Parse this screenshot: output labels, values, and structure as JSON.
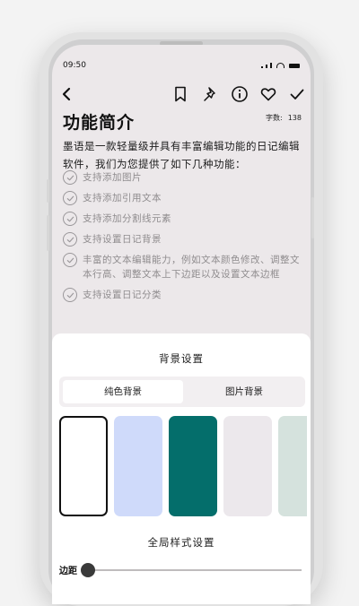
{
  "status": {
    "time": "09:50"
  },
  "toolbar": {
    "icons": [
      "back-icon",
      "bookmark-icon",
      "pin-icon",
      "info-icon",
      "heart-icon",
      "check-icon"
    ]
  },
  "note": {
    "title": "功能简介",
    "word_count_label": "字数:",
    "word_count": "138",
    "intro": "墨语是一款轻量级并具有丰富编辑功能的日记编辑软件，我们为您提供了如下几种功能：",
    "features": [
      "支持添加图片",
      "支持添加引用文本",
      "支持添加分割线元素",
      "支持设置日记背景",
      "丰富的文本编辑能力，例如文本颜色修改、调整文本行高、调整文本上下边距以及设置文本边框",
      "支持设置日记分类"
    ]
  },
  "sheet": {
    "title": "背景设置",
    "tabs": [
      "纯色背景",
      "图片背景"
    ],
    "active_tab": 0,
    "swatches": [
      "#ffffff",
      "#cfdafa",
      "#046e6b",
      "#ece8ec",
      "#d5e2dd"
    ],
    "selected_swatch": 0,
    "global_title": "全局样式设置",
    "margin_label": "边距",
    "margin_value": 0
  },
  "colors": {
    "accent_dark": "#046e6b",
    "screen_bg": "#ece8ea"
  }
}
